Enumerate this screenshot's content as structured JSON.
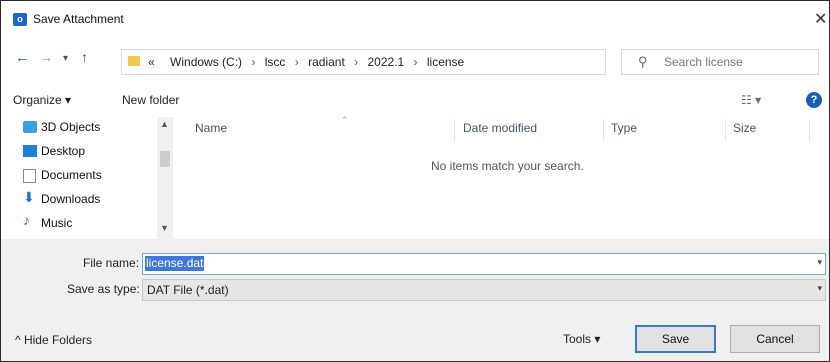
{
  "window": {
    "title": "Save Attachment",
    "app_icon_letter": "o"
  },
  "address": {
    "breadcrumbs": [
      "«",
      "Windows (C:)",
      "lscc",
      "radiant",
      "2022.1",
      "license"
    ],
    "search_placeholder": "Search license"
  },
  "toolbar": {
    "organize": "Organize ▾",
    "new_folder": "New folder"
  },
  "sidebar": {
    "items": [
      {
        "label": "3D Objects",
        "icon": "3d-objects-icon"
      },
      {
        "label": "Desktop",
        "icon": "desktop-icon"
      },
      {
        "label": "Documents",
        "icon": "documents-icon"
      },
      {
        "label": "Downloads",
        "icon": "downloads-icon"
      },
      {
        "label": "Music",
        "icon": "music-icon"
      }
    ]
  },
  "filelist": {
    "columns": [
      "Name",
      "Date modified",
      "Type",
      "Size"
    ],
    "empty_message": "No items match your search."
  },
  "form": {
    "file_name_label": "File name:",
    "file_name_value": "license.dat",
    "save_type_label": "Save as type:",
    "save_type_value": "DAT File (*.dat)"
  },
  "footer": {
    "hide_folders": "^  Hide Folders",
    "tools": "Tools  ▾",
    "save": "Save",
    "cancel": "Cancel"
  }
}
